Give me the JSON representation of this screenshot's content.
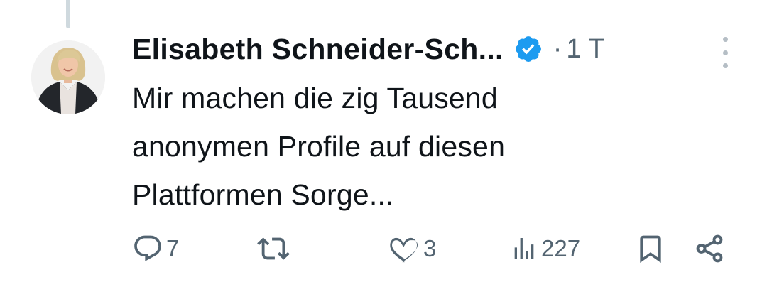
{
  "author": {
    "display_name": "Elisabeth Schneider-Sch...",
    "verified": true,
    "verified_color": "#1d9bf0",
    "avatar_icon": "profile-photo"
  },
  "meta": {
    "separator": "·",
    "timestamp": "1 T"
  },
  "tweet": {
    "text": "Mir machen die zig Tausend\nanonymen Profile auf diesen\nPlattformen Sorge..."
  },
  "actions": {
    "reply": {
      "icon": "reply-icon",
      "count": "7"
    },
    "retweet": {
      "icon": "retweet-icon",
      "count": ""
    },
    "like": {
      "icon": "heart-icon",
      "count": "3"
    },
    "views": {
      "icon": "views-icon",
      "count": "227"
    },
    "bookmark": {
      "icon": "bookmark-icon"
    },
    "share": {
      "icon": "share-icon"
    }
  },
  "colors": {
    "text_primary": "#0f1419",
    "text_secondary": "#536471",
    "thread_line": "#cfd9de",
    "accent": "#1d9bf0"
  }
}
